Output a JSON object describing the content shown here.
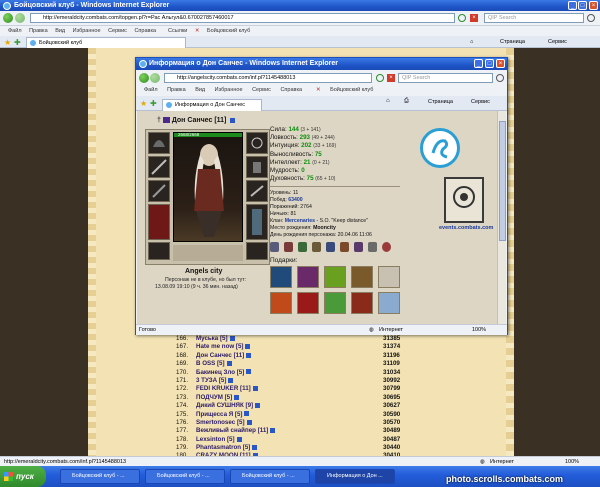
{
  "outer_window": {
    "title": "Бойцовский клуб - Windows Internet Explorer",
    "address": "http://emeraldcity.combats.com/topgen.pl?r=Рас Альгул&0.670027857460017",
    "search_placeholder": "QIP Search",
    "menu": [
      "Файл",
      "Правка",
      "Вид",
      "Избранное",
      "Сервис",
      "Справка"
    ],
    "links_label": "Ссылки",
    "links_item": "Бойцовский клуб",
    "tab": "Бойцовский клуб",
    "page_label": "Страница",
    "service_label": "Сервис",
    "status_url": "http://emeraldcity.combats.com/inf.pl?1145488013",
    "zone": "Интернет",
    "zoom": "100%"
  },
  "popup": {
    "title": "Информация о Дон Санчес - Windows Internet Explorer",
    "address": "http://angelscity.combats.com/inf.pl?1145488013",
    "search_placeholder": "QIP Search",
    "menu": [
      "Файл",
      "Правка",
      "Вид",
      "Избранное",
      "Сервис",
      "Справка"
    ],
    "links_item": "Бойцовский клуб",
    "tab": "Информация о Дон Санчес",
    "page_label": "Страница",
    "service_label": "Сервис",
    "status_left": "Готово",
    "zone": "Интернет",
    "zoom": "100%"
  },
  "character": {
    "name": "Дон Санчес",
    "level": "[11]",
    "hp": "2668/2668",
    "city": "Angels city",
    "absence_line1": "Персонаж не в клубе, но был тут:",
    "absence_line2": "13.08.09 19:10 (9 ч. 36 мин. назад)",
    "stats": [
      {
        "label": "Сила:",
        "value": "144",
        "extra": "(3 + 141)"
      },
      {
        "label": "Ловкость:",
        "value": "293",
        "extra": "(49 + 244)"
      },
      {
        "label": "Интуиция:",
        "value": "202",
        "extra": "(33 + 169)"
      },
      {
        "label": "Выносливость:",
        "value": "75",
        "extra": ""
      },
      {
        "label": "Интеллект:",
        "value": "21",
        "extra": "(0 + 21)"
      },
      {
        "label": "Мудрость:",
        "value": "0",
        "extra": ""
      },
      {
        "label": "Духовность:",
        "value": "75",
        "extra": "(65 + 10)"
      }
    ],
    "info": {
      "level_label": "Уровень:",
      "level_value": "11",
      "wins_label": "Побед:",
      "wins_value": "63400",
      "losses_label": "Поражений:",
      "losses_value": "2764",
      "draws_label": "Ничьих:",
      "draws_value": "81",
      "clan_label": "Клан:",
      "clan_value": "Mercenaries",
      "clan_extra": "- S.O. \"Keep distance\"",
      "birthplace_label": "Место рождения:",
      "birthplace_value": "Mooncity",
      "birthday_label": "День рождения персонажа:",
      "birthday_value": "20.04.06 11:06"
    },
    "site_link": "events.combats.com",
    "gifts_label": "Подарки:"
  },
  "ranking": [
    {
      "num": "166.",
      "name": "Муська",
      "lvl": "[5]",
      "pts": "31385"
    },
    {
      "num": "167.",
      "name": "Hate me now",
      "lvl": "[5]",
      "pts": "31374"
    },
    {
      "num": "168.",
      "name": "Дон Санчес",
      "lvl": "[11]",
      "pts": "31196"
    },
    {
      "num": "169.",
      "name": "B OSS",
      "lvl": "[5]",
      "pts": "31109"
    },
    {
      "num": "170.",
      "name": "Бакинец Зло",
      "lvl": "[5]",
      "pts": "31034"
    },
    {
      "num": "171.",
      "name": "3 ТУЗА",
      "lvl": "[5]",
      "pts": "30992"
    },
    {
      "num": "172.",
      "name": "FEDI KRUKER",
      "lvl": "[11]",
      "pts": "30799"
    },
    {
      "num": "173.",
      "name": "ПОДЧУМ",
      "lvl": "[5]",
      "pts": "30695"
    },
    {
      "num": "174.",
      "name": "Дикий СУШНЯК",
      "lvl": "[9]",
      "pts": "30627"
    },
    {
      "num": "175.",
      "name": "Прищесса Я",
      "lvl": "[5]",
      "pts": "30590"
    },
    {
      "num": "176.",
      "name": "Smertonosec",
      "lvl": "[5]",
      "pts": "30570"
    },
    {
      "num": "177.",
      "name": "Вежливый снайпер",
      "lvl": "[11]",
      "pts": "30489"
    },
    {
      "num": "178.",
      "name": "Lexsinton",
      "lvl": "[5]",
      "pts": "30487"
    },
    {
      "num": "179.",
      "name": "Phantasmatron",
      "lvl": "[5]",
      "pts": "30440"
    },
    {
      "num": "180.",
      "name": "CRAZY MOON",
      "lvl": "[11]",
      "pts": "30410"
    }
  ],
  "taskbar": {
    "start": "пуск",
    "tasks": [
      "Бойцовский клуб - ...",
      "Бойцовский клуб - ...",
      "Бойцовский клуб - ...",
      "Информация о Дон ..."
    ]
  },
  "watermark": "photo.scrolls.combats.com",
  "colors": {
    "title_bar": "#1f55c8",
    "parchment": "#f3e3b4",
    "stat_green": "#0a8f0a",
    "emblem": "#2a9fd6"
  }
}
